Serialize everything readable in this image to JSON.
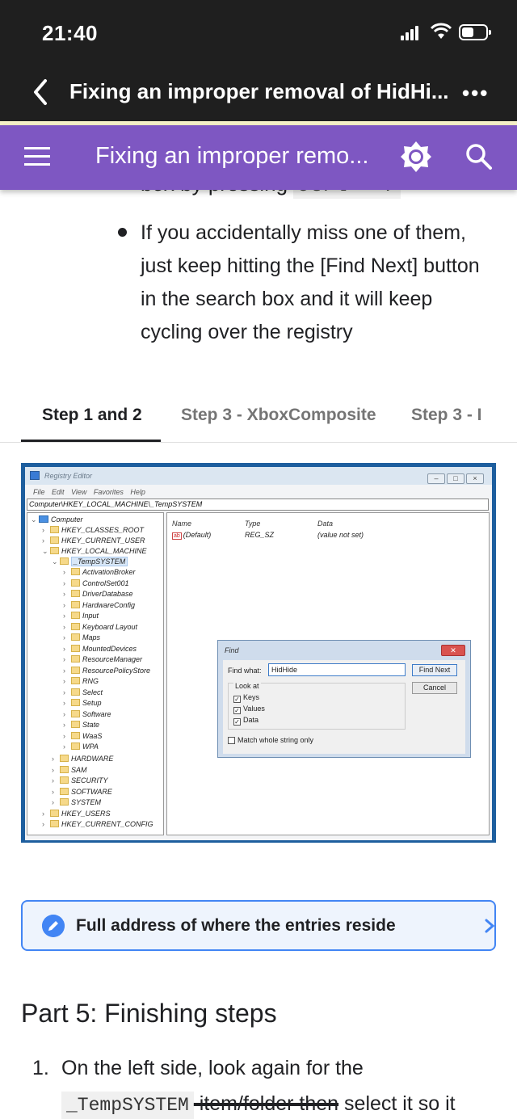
{
  "status_bar": {
    "time": "21:40"
  },
  "browser_header": {
    "title": "Fixing an improper removal of HidHi...",
    "more_label": "•••"
  },
  "toolbar": {
    "title": "Fixing an improper remo...",
    "brand_color": "#7e57c2"
  },
  "content": {
    "partial_text": "box by pressing ",
    "partial_code": "Ctrl + F",
    "bullet": "If you accidentally miss one of them, just keep hitting the [Find Next] button in the search box and it will keep cycling over the registry"
  },
  "tabs": [
    {
      "label": "Step 1 and 2",
      "active": true
    },
    {
      "label": "Step 3 - XboxComposite",
      "active": false
    },
    {
      "label": "Step 3 - I",
      "active": false
    }
  ],
  "registry": {
    "window_title": "Registry Editor",
    "menu": "File Edit View Favorites Help",
    "address": "Computer\\HKEY_LOCAL_MACHINE\\_TempSYSTEM",
    "tree": {
      "computer": "Computer",
      "classes_root": "HKEY_CLASSES_ROOT",
      "current_user": "HKEY_CURRENT_USER",
      "local_machine": "HKEY_LOCAL_MACHINE",
      "temp_system": "_TempSYSTEM",
      "children": [
        "ActivationBroker",
        "ControlSet001",
        "DriverDatabase",
        "HardwareConfig",
        "Input",
        "Keyboard Layout",
        "Maps",
        "MountedDevices",
        "ResourceManager",
        "ResourcePolicyStore",
        "RNG",
        "Select",
        "Setup",
        "Software",
        "State",
        "WaaS",
        "WPA"
      ],
      "lm_children": [
        "HARDWARE",
        "SAM",
        "SECURITY",
        "SOFTWARE",
        "SYSTEM"
      ],
      "users": "HKEY_USERS",
      "current_config": "HKEY_CURRENT_CONFIG"
    },
    "columns": {
      "name": "Name",
      "type": "Type",
      "data": "Data"
    },
    "row": {
      "name": "(Default)",
      "type": "REG_SZ",
      "data": "(value not set)"
    },
    "find": {
      "title": "Find",
      "find_what_label": "Find what:",
      "find_what_value": "HidHide",
      "find_next": "Find Next",
      "cancel": "Cancel",
      "look_at": "Look at",
      "keys": "Keys",
      "values": "Values",
      "data": "Data",
      "match": "Match whole string only"
    }
  },
  "info_card": {
    "text": "Full address of where the entries reside",
    "accent": "#4285f4"
  },
  "section": {
    "heading": "Part 5: Finishing steps"
  },
  "steps": {
    "num": "1.",
    "line1": "On the left side, look again for the",
    "code": "_TempSYSTEM",
    "strike": " item/folder then",
    "rest": " select it so it"
  }
}
